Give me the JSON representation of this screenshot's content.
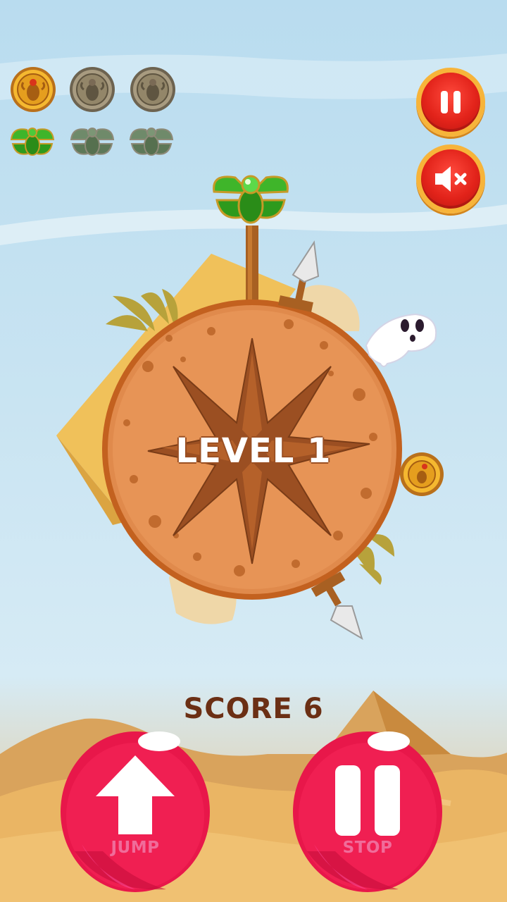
{
  "hud": {
    "collectibles": [
      {
        "name": "gold-scarab-medal",
        "collected": true
      },
      {
        "name": "bronze-scarab-medal",
        "collected": false
      },
      {
        "name": "bronze-scarab-medal",
        "collected": false
      },
      {
        "name": "green-winged-scarab",
        "collected": true
      },
      {
        "name": "green-winged-scarab",
        "collected": false
      },
      {
        "name": "green-winged-scarab",
        "collected": false
      }
    ],
    "pause_icon": "pause-icon",
    "mute_icon": "speaker-muted-icon"
  },
  "game": {
    "level_text": "LEVEL 1",
    "score_label": "SCORE",
    "score_value": "6"
  },
  "controls": {
    "jump_label": "JUMP",
    "stop_label": "STOP",
    "jump_icon": "arrow-up-icon",
    "stop_icon": "pause-bars-icon"
  },
  "colors": {
    "planet": "#e08a4c",
    "planet_rim": "#c3611f",
    "button_pink": "#e8174a",
    "hud_red": "#e2231a",
    "hud_ring": "#f7b43a",
    "sky": "#c9e4f2",
    "sand": "#e8a94c"
  }
}
